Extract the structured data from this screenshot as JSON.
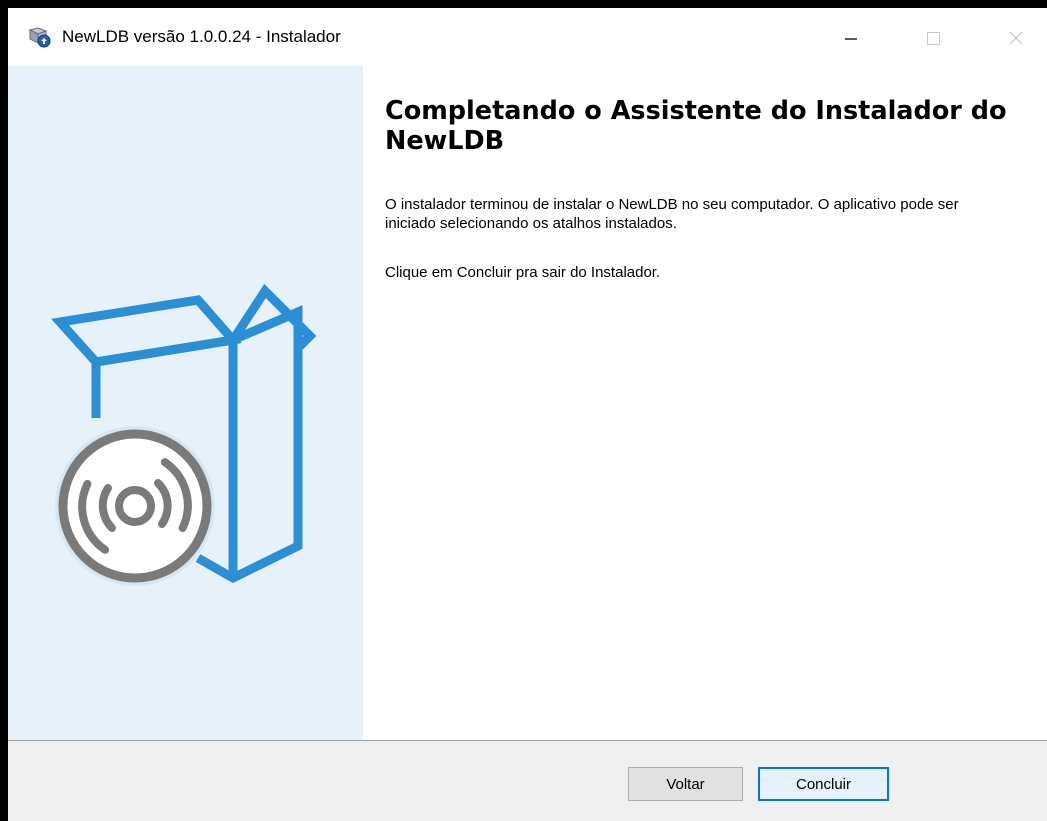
{
  "window": {
    "title": "NewLDB versão 1.0.0.24 - Instalador",
    "app_icon": "installer-icon"
  },
  "titlebar_buttons": {
    "minimize_icon": "minimize-icon",
    "maximize_icon": "maximize-icon",
    "close_icon": "close-icon"
  },
  "sidebar": {
    "illustration": "box-with-disc-icon",
    "background_color": "#e6f1fa",
    "accent_color": "#2b8fd6",
    "disc_color": "#7a7a7a"
  },
  "content": {
    "heading": "Completando o Assistente do Instalador do NewLDB",
    "paragraph1": "O instalador terminou de instalar o NewLDB no seu computador. O aplicativo pode ser iniciado selecionando os atalhos instalados.",
    "paragraph2": "Clique em Concluir pra sair do Instalador."
  },
  "buttons": {
    "back_label": "Voltar",
    "finish_label": "Concluir"
  }
}
